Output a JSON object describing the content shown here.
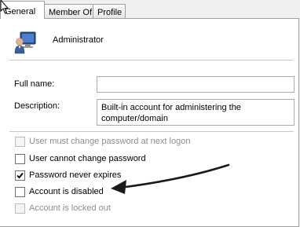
{
  "tabs": [
    {
      "label": "General",
      "active": true
    },
    {
      "label": "Member Of",
      "active": false
    },
    {
      "label": "Profile",
      "active": false
    }
  ],
  "user": {
    "name": "Administrator",
    "icon": "user-account-icon"
  },
  "form": {
    "full_name_label": "Full name:",
    "full_name_value": "",
    "description_label": "Description:",
    "description_value": "Built-in account for administering the computer/domain"
  },
  "options": [
    {
      "label": "User must change password at next logon",
      "checked": false,
      "enabled": false
    },
    {
      "label": "User cannot change password",
      "checked": false,
      "enabled": true
    },
    {
      "label": "Password never expires",
      "checked": true,
      "enabled": true
    },
    {
      "label": "Account is disabled",
      "checked": false,
      "enabled": true
    },
    {
      "label": "Account is locked out",
      "checked": false,
      "enabled": false
    }
  ],
  "colors": {
    "annotation_arrow": "#1a1a1a",
    "disabled_text": "#8d8d8d",
    "tab_border": "#a0a0a0"
  }
}
